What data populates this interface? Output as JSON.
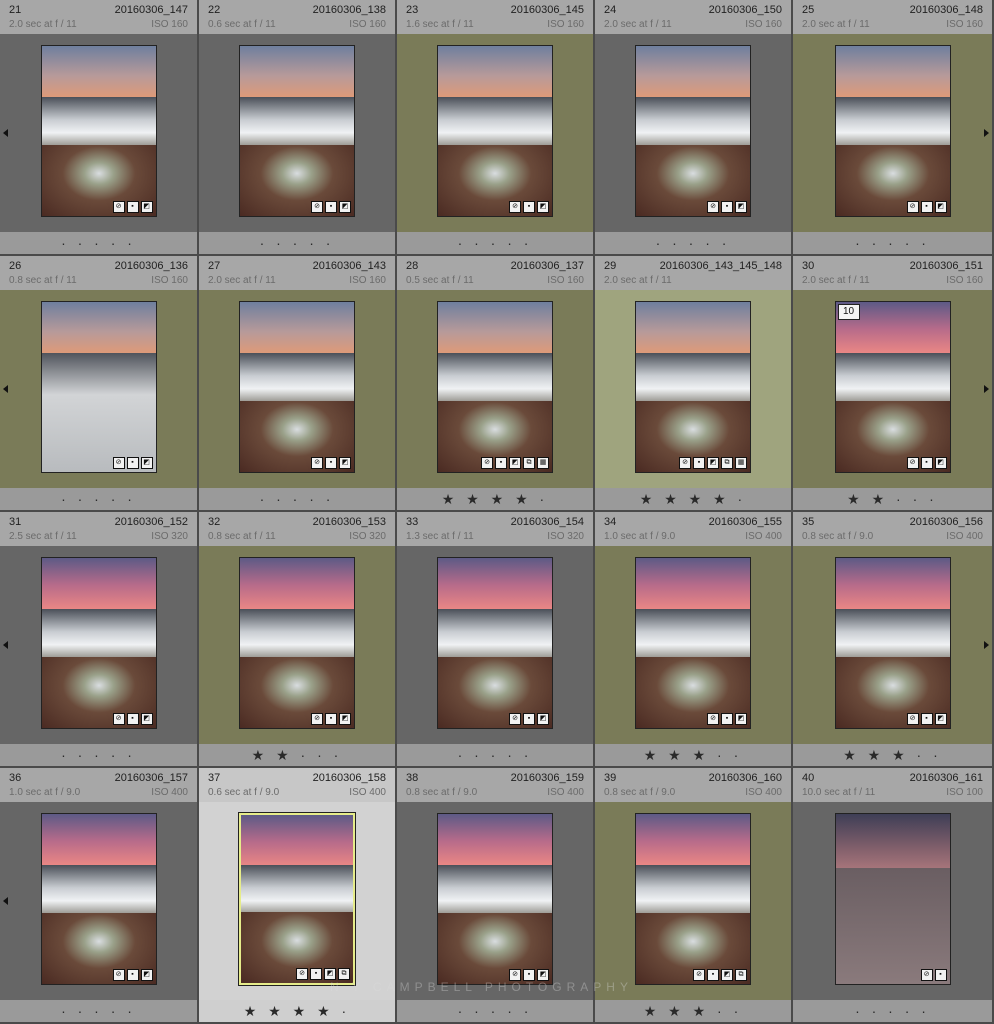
{
  "watermark": "N Y CAMPBELL PHOTOGRAPHY",
  "colors": {
    "grey_bg": "#666666",
    "olive_bg": "#7a7b58",
    "selected_bg": "#9fa47e",
    "active_bg": "#d2d2d2"
  },
  "icons": [
    "keyword-tag-icon",
    "metadata-icon",
    "crop-icon",
    "copy-settings-icon",
    "grid-icon",
    "nav-arrow-left-icon",
    "nav-arrow-right-icon"
  ],
  "cells": [
    {
      "num": "21",
      "file": "20160306_147",
      "exp": "2.0 sec at f / 11",
      "iso": "ISO 160",
      "bg": "grey",
      "rating": "· · · · ·",
      "thumb": "",
      "badges": 3
    },
    {
      "num": "22",
      "file": "20160306_138",
      "exp": "0.6 sec at f / 11",
      "iso": "ISO 160",
      "bg": "grey",
      "rating": "· · · · ·",
      "thumb": "",
      "badges": 3
    },
    {
      "num": "23",
      "file": "20160306_145",
      "exp": "1.6 sec at f / 11",
      "iso": "ISO 160",
      "bg": "olive",
      "rating": "· · · · ·",
      "thumb": "",
      "badges": 3
    },
    {
      "num": "24",
      "file": "20160306_150",
      "exp": "2.0 sec at f / 11",
      "iso": "ISO 160",
      "bg": "grey",
      "rating": "· · · · ·",
      "thumb": "",
      "badges": 3
    },
    {
      "num": "25",
      "file": "20160306_148",
      "exp": "2.0 sec at f / 11",
      "iso": "ISO 160",
      "bg": "olive",
      "rating": "· · · · ·",
      "thumb": "",
      "badges": 3
    },
    {
      "num": "26",
      "file": "20160306_136",
      "exp": "0.8 sec at f / 11",
      "iso": "ISO 160",
      "bg": "olive",
      "rating": "· · · · ·",
      "thumb": "smooth",
      "badges": 3
    },
    {
      "num": "27",
      "file": "20160306_143",
      "exp": "2.0 sec at f / 11",
      "iso": "ISO 160",
      "bg": "olive",
      "rating": "· · · · ·",
      "thumb": "",
      "badges": 3
    },
    {
      "num": "28",
      "file": "20160306_137",
      "exp": "0.5 sec at f / 11",
      "iso": "ISO 160",
      "bg": "olive",
      "rating": "★ ★ ★ ★ ·",
      "thumb": "",
      "badges": 5
    },
    {
      "num": "29",
      "file": "20160306_143_145_148",
      "exp": "2.0 sec at f / 11",
      "iso": "",
      "bg": "selected",
      "rating": "★ ★ ★ ★ ·",
      "thumb": "",
      "badges": 5
    },
    {
      "num": "30",
      "file": "20160306_151",
      "exp": "2.0 sec at f / 11",
      "iso": "ISO 160",
      "bg": "olive",
      "rating": "★ ★ · · ·",
      "thumb": "pink",
      "badges": 3,
      "flag": "10"
    },
    {
      "num": "31",
      "file": "20160306_152",
      "exp": "2.5 sec at f / 11",
      "iso": "ISO 320",
      "bg": "grey",
      "rating": "· · · · ·",
      "thumb": "pink",
      "badges": 3
    },
    {
      "num": "32",
      "file": "20160306_153",
      "exp": "0.8 sec at f / 11",
      "iso": "ISO 320",
      "bg": "olive",
      "rating": "★ ★ · · ·",
      "thumb": "pink",
      "badges": 3
    },
    {
      "num": "33",
      "file": "20160306_154",
      "exp": "1.3 sec at f / 11",
      "iso": "ISO 320",
      "bg": "grey",
      "rating": "· · · · ·",
      "thumb": "pink",
      "badges": 3
    },
    {
      "num": "34",
      "file": "20160306_155",
      "exp": "1.0 sec at f / 9.0",
      "iso": "ISO 400",
      "bg": "olive",
      "rating": "★ ★ ★ · ·",
      "thumb": "pink",
      "badges": 3
    },
    {
      "num": "35",
      "file": "20160306_156",
      "exp": "0.8 sec at f / 9.0",
      "iso": "ISO 400",
      "bg": "olive",
      "rating": "★ ★ ★ · ·",
      "thumb": "pink",
      "badges": 3
    },
    {
      "num": "36",
      "file": "20160306_157",
      "exp": "1.0 sec at f / 9.0",
      "iso": "ISO 400",
      "bg": "grey",
      "rating": "· · · · ·",
      "thumb": "pink",
      "badges": 3
    },
    {
      "num": "37",
      "file": "20160306_158",
      "exp": "0.6 sec at f / 9.0",
      "iso": "ISO 400",
      "bg": "active",
      "rating": "★ ★ ★ ★ ·",
      "thumb": "pink hl",
      "badges": 4
    },
    {
      "num": "38",
      "file": "20160306_159",
      "exp": "0.8 sec at f / 9.0",
      "iso": "ISO 400",
      "bg": "grey",
      "rating": "· · · · ·",
      "thumb": "pink",
      "badges": 3
    },
    {
      "num": "39",
      "file": "20160306_160",
      "exp": "0.8 sec at f / 9.0",
      "iso": "ISO 400",
      "bg": "olive",
      "rating": "★ ★ ★ · ·",
      "thumb": "pink",
      "badges": 4
    },
    {
      "num": "40",
      "file": "20160306_161",
      "exp": "10.0 sec at f / 11",
      "iso": "ISO 100",
      "bg": "grey",
      "rating": "· · · · ·",
      "thumb": "dusk",
      "badges": 2
    }
  ]
}
